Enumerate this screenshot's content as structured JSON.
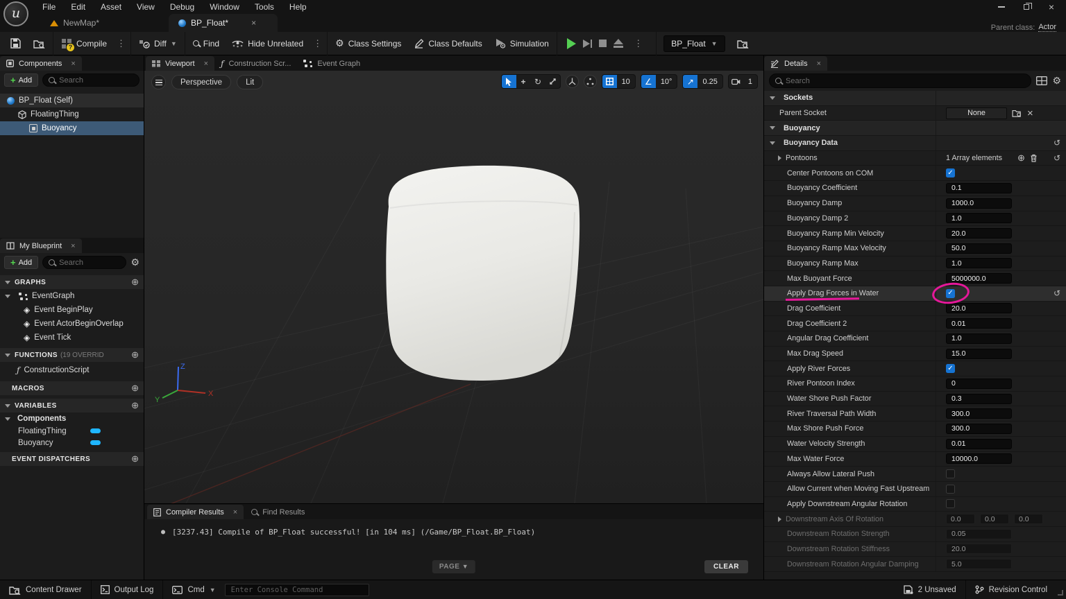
{
  "titlebar": {
    "menu": [
      "File",
      "Edit",
      "Asset",
      "View",
      "Debug",
      "Window",
      "Tools",
      "Help"
    ],
    "parent_class_label": "Parent class:",
    "parent_class_value": "Actor"
  },
  "doc_tabs": {
    "map_tab": "NewMap*",
    "blueprint_tab": "BP_Float*"
  },
  "toolbar": {
    "compile": "Compile",
    "diff": "Diff",
    "find": "Find",
    "hide_unrelated": "Hide Unrelated",
    "class_settings": "Class Settings",
    "class_defaults": "Class Defaults",
    "simulation": "Simulation",
    "active_blueprint": "BP_Float"
  },
  "components_panel": {
    "title": "Components",
    "add_label": "Add",
    "search_placeholder": "Search",
    "tree": [
      {
        "label": "BP_Float (Self)",
        "icon": "blueprint-orb",
        "depth": 0,
        "root": true,
        "selected": false
      },
      {
        "label": "FloatingThing",
        "icon": "static-mesh-cube",
        "depth": 1,
        "root": false,
        "selected": false
      },
      {
        "label": "Buoyancy",
        "icon": "component-box",
        "depth": 2,
        "root": false,
        "selected": true
      }
    ]
  },
  "my_blueprint": {
    "title": "My Blueprint",
    "add_label": "Add",
    "search_placeholder": "Search",
    "graphs_header": "GRAPHS",
    "event_graph": "EventGraph",
    "events": [
      "Event BeginPlay",
      "Event ActorBeginOverlap",
      "Event Tick"
    ],
    "functions_header": "FUNCTIONS",
    "functions_note": "(19 OVERRID",
    "construction_script": "ConstructionScript",
    "macros_header": "MACROS",
    "variables_header": "VARIABLES",
    "components_group": "Components",
    "variables": [
      "FloatingThing",
      "Buoyancy"
    ],
    "event_dispatchers_header": "EVENT DISPATCHERS"
  },
  "viewport": {
    "tab_viewport": "Viewport",
    "tab_construction": "Construction Scr...",
    "tab_event_graph": "Event Graph",
    "perspective": "Perspective",
    "lit": "Lit",
    "grid_snap": "10",
    "rotation_snap": "10°",
    "scale_snap": "0.25",
    "camera_speed": "1",
    "axis_x": "X",
    "axis_y": "Y",
    "axis_z": "Z"
  },
  "bottom_panel": {
    "tab_compiler": "Compiler Results",
    "tab_find": "Find Results",
    "log_line": "[3237.43] Compile of BP_Float successful! [in 104 ms] (/Game/BP_Float.BP_Float)",
    "page_button": "PAGE",
    "clear_button": "CLEAR"
  },
  "details": {
    "title": "Details",
    "search_placeholder": "Search",
    "rows": [
      {
        "t": "sec",
        "label": "Sockets"
      },
      {
        "t": "prop",
        "label": "Parent Socket",
        "ctrl": "socket",
        "value": "None",
        "ind": 1
      },
      {
        "t": "sec",
        "label": "Buoyancy"
      },
      {
        "t": "cat",
        "label": "Buoyancy Data",
        "reset": true
      },
      {
        "t": "prop",
        "label": "Pontoons",
        "ctrl": "array",
        "value": "1 Array elements",
        "exp": true,
        "reset": true,
        "ind": 2
      },
      {
        "t": "prop",
        "label": "Center Pontoons on COM",
        "ctrl": "check",
        "checked": true,
        "ind": 2
      },
      {
        "t": "prop",
        "label": "Buoyancy Coefficient",
        "ctrl": "input",
        "value": "0.1",
        "ind": 2
      },
      {
        "t": "prop",
        "label": "Buoyancy Damp",
        "ctrl": "input",
        "value": "1000.0",
        "ind": 2
      },
      {
        "t": "prop",
        "label": "Buoyancy Damp 2",
        "ctrl": "input",
        "value": "1.0",
        "ind": 2
      },
      {
        "t": "prop",
        "label": "Buoyancy Ramp Min Velocity",
        "ctrl": "input",
        "value": "20.0",
        "ind": 2
      },
      {
        "t": "prop",
        "label": "Buoyancy Ramp Max Velocity",
        "ctrl": "input",
        "value": "50.0",
        "ind": 2
      },
      {
        "t": "prop",
        "label": "Buoyancy Ramp Max",
        "ctrl": "input",
        "value": "1.0",
        "ind": 2
      },
      {
        "t": "prop",
        "label": "Max Buoyant Force",
        "ctrl": "input",
        "value": "5000000.0",
        "ind": 2
      },
      {
        "t": "prop",
        "label": "Apply Drag Forces in Water",
        "ctrl": "check",
        "checked": true,
        "ind": 2,
        "hl": true,
        "annot": true,
        "reset": true
      },
      {
        "t": "prop",
        "label": "Drag Coefficient",
        "ctrl": "input",
        "value": "20.0",
        "ind": 2
      },
      {
        "t": "prop",
        "label": "Drag Coefficient 2",
        "ctrl": "input",
        "value": "0.01",
        "ind": 2
      },
      {
        "t": "prop",
        "label": "Angular Drag Coefficient",
        "ctrl": "input",
        "value": "1.0",
        "ind": 2
      },
      {
        "t": "prop",
        "label": "Max Drag Speed",
        "ctrl": "input",
        "value": "15.0",
        "ind": 2
      },
      {
        "t": "prop",
        "label": "Apply River Forces",
        "ctrl": "check",
        "checked": true,
        "ind": 2
      },
      {
        "t": "prop",
        "label": "River Pontoon Index",
        "ctrl": "input",
        "value": "0",
        "ind": 2
      },
      {
        "t": "prop",
        "label": "Water Shore Push Factor",
        "ctrl": "input",
        "value": "0.3",
        "ind": 2
      },
      {
        "t": "prop",
        "label": "River Traversal Path Width",
        "ctrl": "input",
        "value": "300.0",
        "ind": 2
      },
      {
        "t": "prop",
        "label": "Max Shore Push Force",
        "ctrl": "input",
        "value": "300.0",
        "ind": 2
      },
      {
        "t": "prop",
        "label": "Water Velocity Strength",
        "ctrl": "input",
        "value": "0.01",
        "ind": 2
      },
      {
        "t": "prop",
        "label": "Max Water Force",
        "ctrl": "input",
        "value": "10000.0",
        "ind": 2
      },
      {
        "t": "prop",
        "label": "Always Allow Lateral Push",
        "ctrl": "check",
        "checked": false,
        "ind": 2
      },
      {
        "t": "prop",
        "label": "Allow Current when Moving Fast Upstream",
        "ctrl": "check",
        "checked": false,
        "ind": 2
      },
      {
        "t": "prop",
        "label": "Apply Downstream Angular Rotation",
        "ctrl": "check",
        "checked": false,
        "ind": 2
      },
      {
        "t": "prop",
        "label": "Downstream Axis Of Rotation",
        "ctrl": "vec3",
        "values": [
          "0.0",
          "0.0",
          "0.0"
        ],
        "dis": true,
        "exp": true,
        "ind": 2
      },
      {
        "t": "prop",
        "label": "Downstream Rotation Strength",
        "ctrl": "input",
        "value": "0.05",
        "dis": true,
        "ind": 2
      },
      {
        "t": "prop",
        "label": "Downstream Rotation Stiffness",
        "ctrl": "input",
        "value": "20.0",
        "dis": true,
        "ind": 2
      },
      {
        "t": "prop",
        "label": "Downstream Rotation Angular Damping",
        "ctrl": "input",
        "value": "5.0",
        "dis": true,
        "ind": 2
      }
    ]
  },
  "statusbar": {
    "content_drawer": "Content Drawer",
    "output_log": "Output Log",
    "cmd": "Cmd",
    "console_placeholder": "Enter Console Command",
    "unsaved": "2 Unsaved",
    "revision_control": "Revision Control"
  },
  "colors": {
    "accent_blue": "#1673d2",
    "selection_blue": "#3d5a77",
    "variable_pill_blue": "#1fb6ff",
    "annotation_pink": "#e6189a",
    "play_green": "#55cf53",
    "compile_badge_yellow": "#e8c41c"
  }
}
